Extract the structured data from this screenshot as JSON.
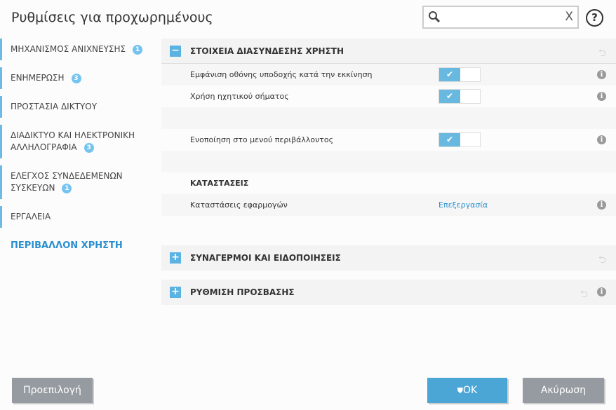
{
  "title": "Ρυθμίσεις για προχωρημένους",
  "search": {
    "value": "",
    "clear": "X"
  },
  "help": "?",
  "sidebar": [
    {
      "label": "ΜΗΧΑΝΙΣΜΟΣ ΑΝΙΧΝΕΥΣΗΣ",
      "badge": "1"
    },
    {
      "label": "ΕΝΗΜΕΡΩΣΗ",
      "badge": "3"
    },
    {
      "label": "ΠΡΟΣΤΑΣΙΑ ΔΙΚΤΥΟΥ"
    },
    {
      "label": "ΔΙΑΔΙΚΤΥΟ ΚΑΙ ΗΛΕΚΤΡΟΝΙΚΗ ΑΛΛΗΛΟΓΡΑΦΙΑ",
      "badge": "3"
    },
    {
      "label": "ΕΛΕΓΧΟΣ ΣΥΝΔΕΔΕΜΕΝΩΝ ΣΥΣΚΕΥΩΝ",
      "badge": "1"
    },
    {
      "label": "ΕΡΓΑΛΕΙΑ"
    },
    {
      "label": "ΠΕΡΙΒΑΛΛΟΝ ΧΡΗΣΤΗ",
      "active": true
    }
  ],
  "sections": {
    "ui": {
      "title": "ΣΤΟΙΧΕΙΑ ΔΙΑΣΥΝΔΕΣΗΣ ΧΡΗΣΤΗ",
      "expand": "−",
      "rows": [
        {
          "label": "Εμφάνιση οθόνης υποδοχής κατά την εκκίνηση",
          "enabled": true
        },
        {
          "label": "Χρήση ηχητικού σήματος",
          "enabled": true
        },
        {
          "label": "Ενοποίηση στο μενού περιβάλλοντος",
          "enabled": true
        }
      ],
      "states_heading": "ΚΑΤΑΣΤΑΣΕΙΣ",
      "app_states": {
        "label": "Καταστάσεις εφαρμογών",
        "link": "Επεξεργασία"
      }
    },
    "alerts": {
      "title": "ΣΥΝΑΓΕΡΜΟΙ ΚΑΙ ΕΙΔΟΠΟΙΗΣΕΙΣ",
      "expand": "+"
    },
    "access": {
      "title": "ΡΥΘΜΙΣΗ ΠΡΟΣΒΑΣΗΣ",
      "expand": "+"
    }
  },
  "icons": {
    "check": "✔",
    "undo": "⮌",
    "info": "i"
  },
  "buttons": {
    "default": "Προεπιλογή",
    "ok": "OK",
    "cancel": "Ακύρωση"
  }
}
